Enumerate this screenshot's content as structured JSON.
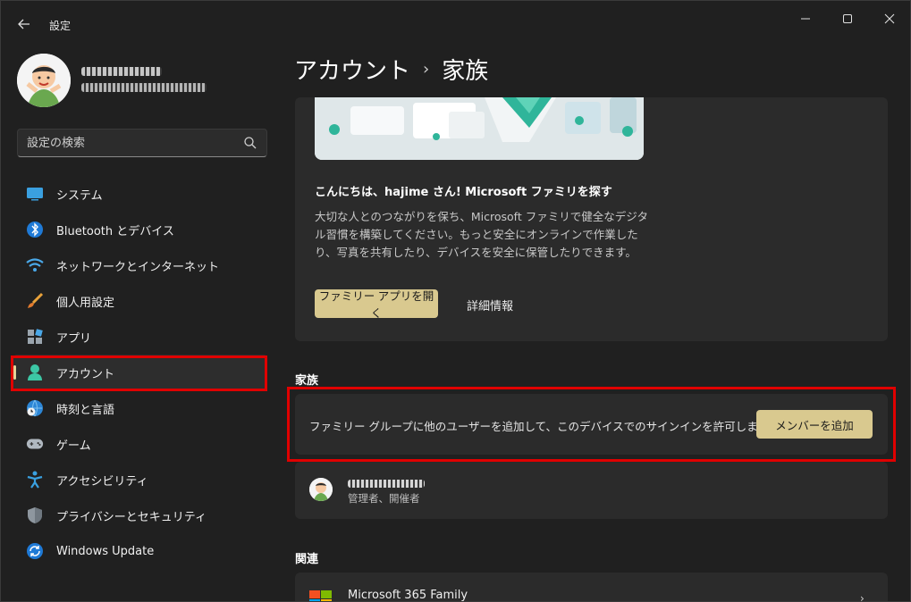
{
  "window": {
    "app_title": "設定",
    "back_icon": "back-arrow-icon",
    "controls": [
      "minimize-icon",
      "maximize-icon",
      "close-icon"
    ]
  },
  "search": {
    "placeholder": "設定の検索",
    "icon": "search-icon"
  },
  "nav": {
    "items": [
      {
        "label": "システム",
        "icon": "system-icon"
      },
      {
        "label": "Bluetooth とデバイス",
        "icon": "bluetooth-icon"
      },
      {
        "label": "ネットワークとインターネット",
        "icon": "wifi-icon"
      },
      {
        "label": "個人用設定",
        "icon": "brush-icon"
      },
      {
        "label": "アプリ",
        "icon": "apps-icon"
      },
      {
        "label": "アカウント",
        "icon": "account-icon",
        "selected": true
      },
      {
        "label": "時刻と言語",
        "icon": "clock-globe-icon"
      },
      {
        "label": "ゲーム",
        "icon": "gamepad-icon"
      },
      {
        "label": "アクセシビリティ",
        "icon": "accessibility-icon"
      },
      {
        "label": "プライバシーとセキュリティ",
        "icon": "shield-icon"
      },
      {
        "label": "Windows Update",
        "icon": "update-icon"
      }
    ]
  },
  "breadcrumb": {
    "parent": "アカウント",
    "separator": "›",
    "current": "家族"
  },
  "family_card": {
    "heading": "こんにちは、hajime さん! Microsoft ファミリを探す",
    "description": "大切な人とのつながりを保ち、Microsoft ファミリで健全なデジタル習慣を構築してください。もっと安全にオンラインで作業したり、写真を共有したり、デバイスを安全に保管したりできます。",
    "open_app_button": "ファミリー アプリを開く",
    "details_link": "詳細情報"
  },
  "family_section": {
    "title": "家族",
    "add_text": "ファミリー グループに他のユーザーを追加して、このデバイスでのサインインを許可します",
    "add_button": "メンバーを追加",
    "member_role": "管理者、開催者"
  },
  "related": {
    "title": "関連",
    "item_label": "Microsoft 365 Family"
  },
  "colors": {
    "background": "#202020",
    "card": "#2b2b2b",
    "accent_button": "#d9c98f",
    "highlight_box": "#e00000"
  }
}
